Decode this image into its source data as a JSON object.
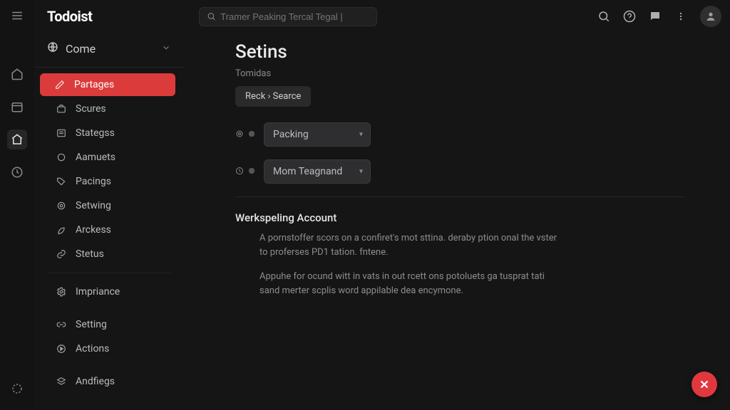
{
  "brand": "Todoist",
  "search": {
    "placeholder": "Tramer Peaking Tercal Tegal |"
  },
  "workspace": {
    "label": "Come"
  },
  "sidebar": {
    "section1": [
      {
        "label": "Partages"
      },
      {
        "label": "Scures"
      },
      {
        "label": "Stategss"
      },
      {
        "label": "Aamuets"
      },
      {
        "label": "Pacings"
      },
      {
        "label": "Setwing"
      },
      {
        "label": "Arckess"
      },
      {
        "label": "Stetus"
      }
    ],
    "section2": [
      {
        "label": "Impriance"
      }
    ],
    "section3": [
      {
        "label": "Setting"
      },
      {
        "label": "Actions"
      }
    ],
    "section4": [
      {
        "label": "Andfiegs"
      }
    ]
  },
  "main": {
    "title": "Setins",
    "subtitle": "Tomidas",
    "source_button": "Reck › Searce",
    "select1": "Packing",
    "select2": "Mom Teagnand",
    "section_title": "Werkspeling Account",
    "para1": "A pornstoffer scors on a confiret's mot sttina. deraby ption onal the vster to proferses PD1 tation. fntene.",
    "para2": "Appuhe for ocund witt in vats in out rcett ons potoluets ga tusprat tati sand merter scplis word appilable dea encymone."
  }
}
